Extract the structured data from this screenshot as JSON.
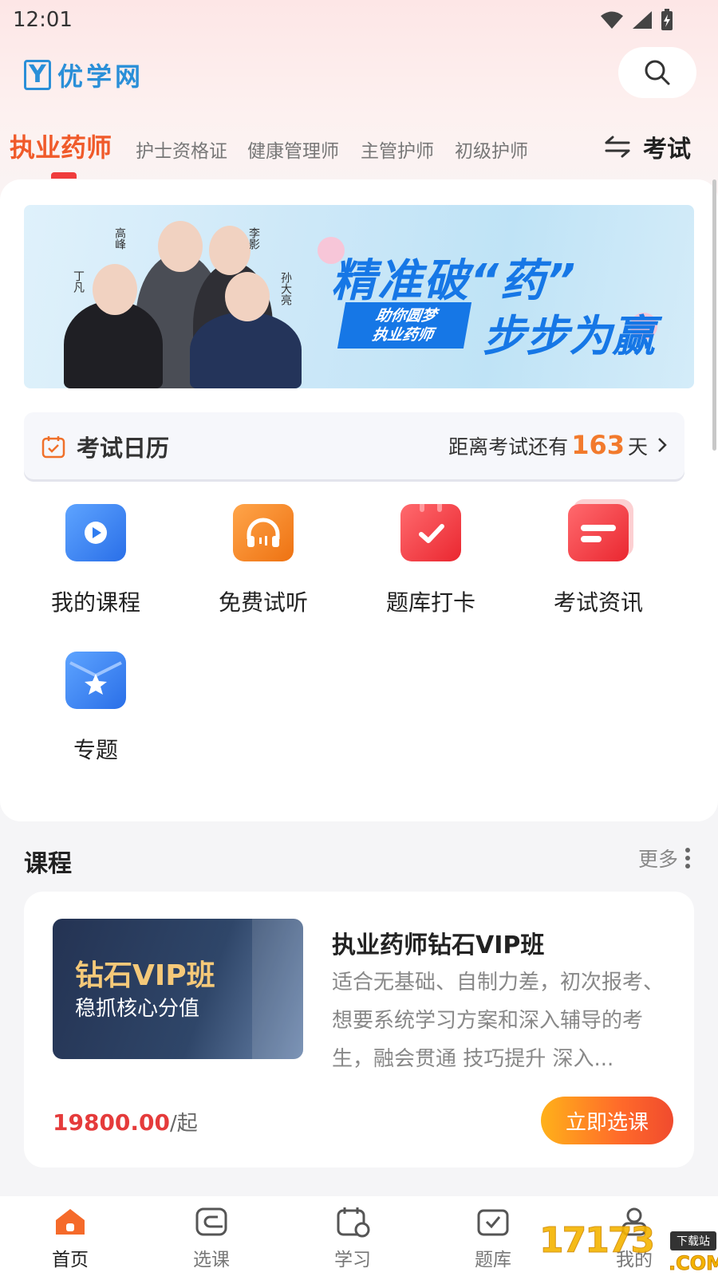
{
  "status_bar": {
    "time": "12:01"
  },
  "header": {
    "logo_mark": "Y",
    "logo_text": "优学网"
  },
  "categories": {
    "active": "执业药师",
    "items": [
      "护士资格证",
      "健康管理师",
      "主管护师",
      "初级护师"
    ],
    "switch_label": "考试"
  },
  "banner": {
    "title": "精准破“药”",
    "pill_line1": "助你圆梦",
    "pill_line2": "执业药师",
    "slogan": "步步为赢",
    "teachers": [
      "高峰",
      "李影",
      "丁凡",
      "孙大亮"
    ]
  },
  "exam_calendar": {
    "title": "考试日历",
    "countdown_prefix": "距离考试还有",
    "days": "163",
    "countdown_suffix": "天"
  },
  "features": [
    {
      "label": "我的课程",
      "icon": "video-play-icon",
      "color": "#2f7cf0"
    },
    {
      "label": "免费试听",
      "icon": "headphones-icon",
      "color": "#f0851e"
    },
    {
      "label": "题库打卡",
      "icon": "calendar-check-icon",
      "color": "#f23d44"
    },
    {
      "label": "考试资讯",
      "icon": "news-icon",
      "color": "#f23d44"
    },
    {
      "label": "专题",
      "icon": "star-folder-icon",
      "color": "#2f7cf0"
    }
  ],
  "course_section": {
    "title": "课程",
    "more": "更多"
  },
  "course": {
    "thumb_title": "钻石VIP班",
    "thumb_subtitle": "稳抓核心分值",
    "name": "执业药师钻石VIP班",
    "description": "适合无基础、自制力差，初次报考、想要系统学习方案和深入辅导的考生，融会贯通 技巧提升  深入...",
    "price": "19800.00",
    "price_unit": "/起",
    "button": "立即选课"
  },
  "tabbar": [
    {
      "label": "首页",
      "icon": "home-icon",
      "active": true
    },
    {
      "label": "选课",
      "icon": "course-select-icon",
      "active": false
    },
    {
      "label": "学习",
      "icon": "study-calendar-icon",
      "active": false
    },
    {
      "label": "题库",
      "icon": "question-bank-icon",
      "active": false
    },
    {
      "label": "我的",
      "icon": "profile-icon",
      "active": false
    }
  ],
  "watermark": {
    "text": "17173",
    "tag": "下载站",
    "suffix": ".COM"
  },
  "colors": {
    "accent": "#f05a2a",
    "brand": "#2a8fd8",
    "price": "#e53b3b",
    "countdown": "#f27a2c"
  }
}
